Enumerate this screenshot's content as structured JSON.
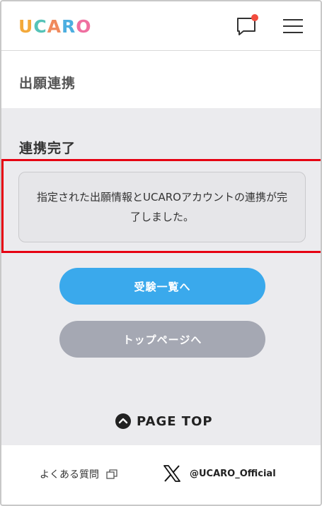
{
  "header": {
    "logo_letters": [
      {
        "char": "U",
        "color": "#f3a93b"
      },
      {
        "char": "C",
        "color": "#55c3b8"
      },
      {
        "char": "A",
        "color": "#f08a5d"
      },
      {
        "char": "R",
        "color": "#4caee0"
      },
      {
        "char": "O",
        "color": "#ef6fa0"
      }
    ],
    "message_icon": "speech-bubble-icon",
    "notification_color": "#f24c3d",
    "menu_icon": "hamburger-icon"
  },
  "page": {
    "title": "出願連携"
  },
  "main": {
    "section_title": "連携完了",
    "message": "指定された出願情報とUCAROアカウントの連携が完了しました。",
    "primary_button_label": "受験一覧へ",
    "secondary_button_label": "トップページへ",
    "page_top_label": "PAGE TOP"
  },
  "footer": {
    "faq_label": "よくある質問",
    "x_handle": "@UCARO_Official"
  },
  "colors": {
    "primary": "#3aa9ec",
    "secondary": "#a5a8b3",
    "highlight": "#e60012",
    "background": "#ebebee"
  }
}
